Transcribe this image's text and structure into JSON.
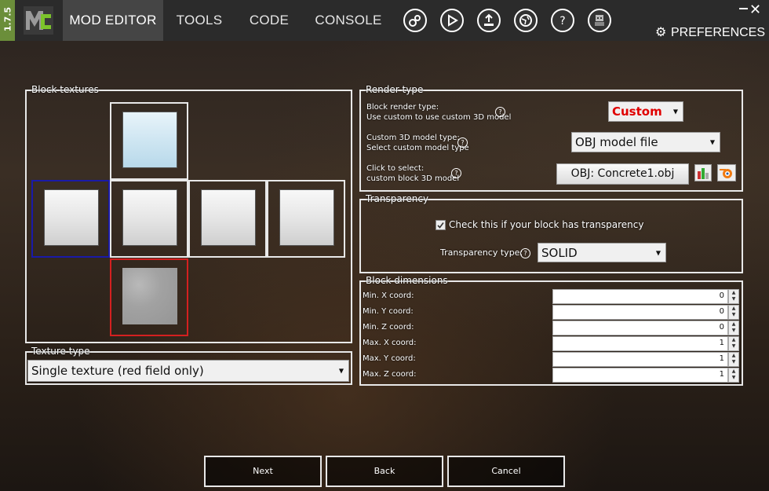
{
  "app": {
    "version": "1.7.5"
  },
  "nav": {
    "tabs": [
      {
        "label": "MOD EDITOR",
        "active": true
      },
      {
        "label": "TOOLS"
      },
      {
        "label": "CODE"
      },
      {
        "label": "CONSOLE"
      }
    ],
    "icons": [
      "workspace-settings-icon",
      "run-icon",
      "export-icon",
      "browser-icon",
      "help-icon",
      "account-icon"
    ],
    "preferences_label": "PREFERENCES"
  },
  "block_textures": {
    "legend": "Block textures",
    "selected_color": "#1a1aa8",
    "red_field_color": "#d42020"
  },
  "texture_type": {
    "legend": "Texture type",
    "value": "Single texture (red field only)"
  },
  "render_type": {
    "legend": "Render type",
    "block_render_type": {
      "label": "Block render type:",
      "hint": "Use custom to use custom 3D model",
      "value": "Custom",
      "value_color": "#e00000"
    },
    "model_type": {
      "label": "Custom 3D model type:",
      "hint": "Select custom model type",
      "value": "OBJ model file"
    },
    "model_select": {
      "label": "Click to select:",
      "hint": "custom block 3D model",
      "value": "OBJ: Concrete1.obj"
    }
  },
  "transparency": {
    "legend": "Transparency",
    "checkbox_label": "Check this if your block has transparency",
    "checked": true,
    "type_label": "Transparency type:",
    "type_value": "SOLID"
  },
  "block_dimensions": {
    "legend": "Block dimensions",
    "rows": [
      {
        "label": "Min. X coord:",
        "value": "0"
      },
      {
        "label": "Min. Y coord:",
        "value": "0"
      },
      {
        "label": "Min. Z coord:",
        "value": "0"
      },
      {
        "label": "Max. X coord:",
        "value": "1"
      },
      {
        "label": "Max. Y coord:",
        "value": "1"
      },
      {
        "label": "Max. Z coord:",
        "value": "1"
      }
    ]
  },
  "footer": {
    "next_label": "Next",
    "back_label": "Back",
    "cancel_label": "Cancel"
  }
}
